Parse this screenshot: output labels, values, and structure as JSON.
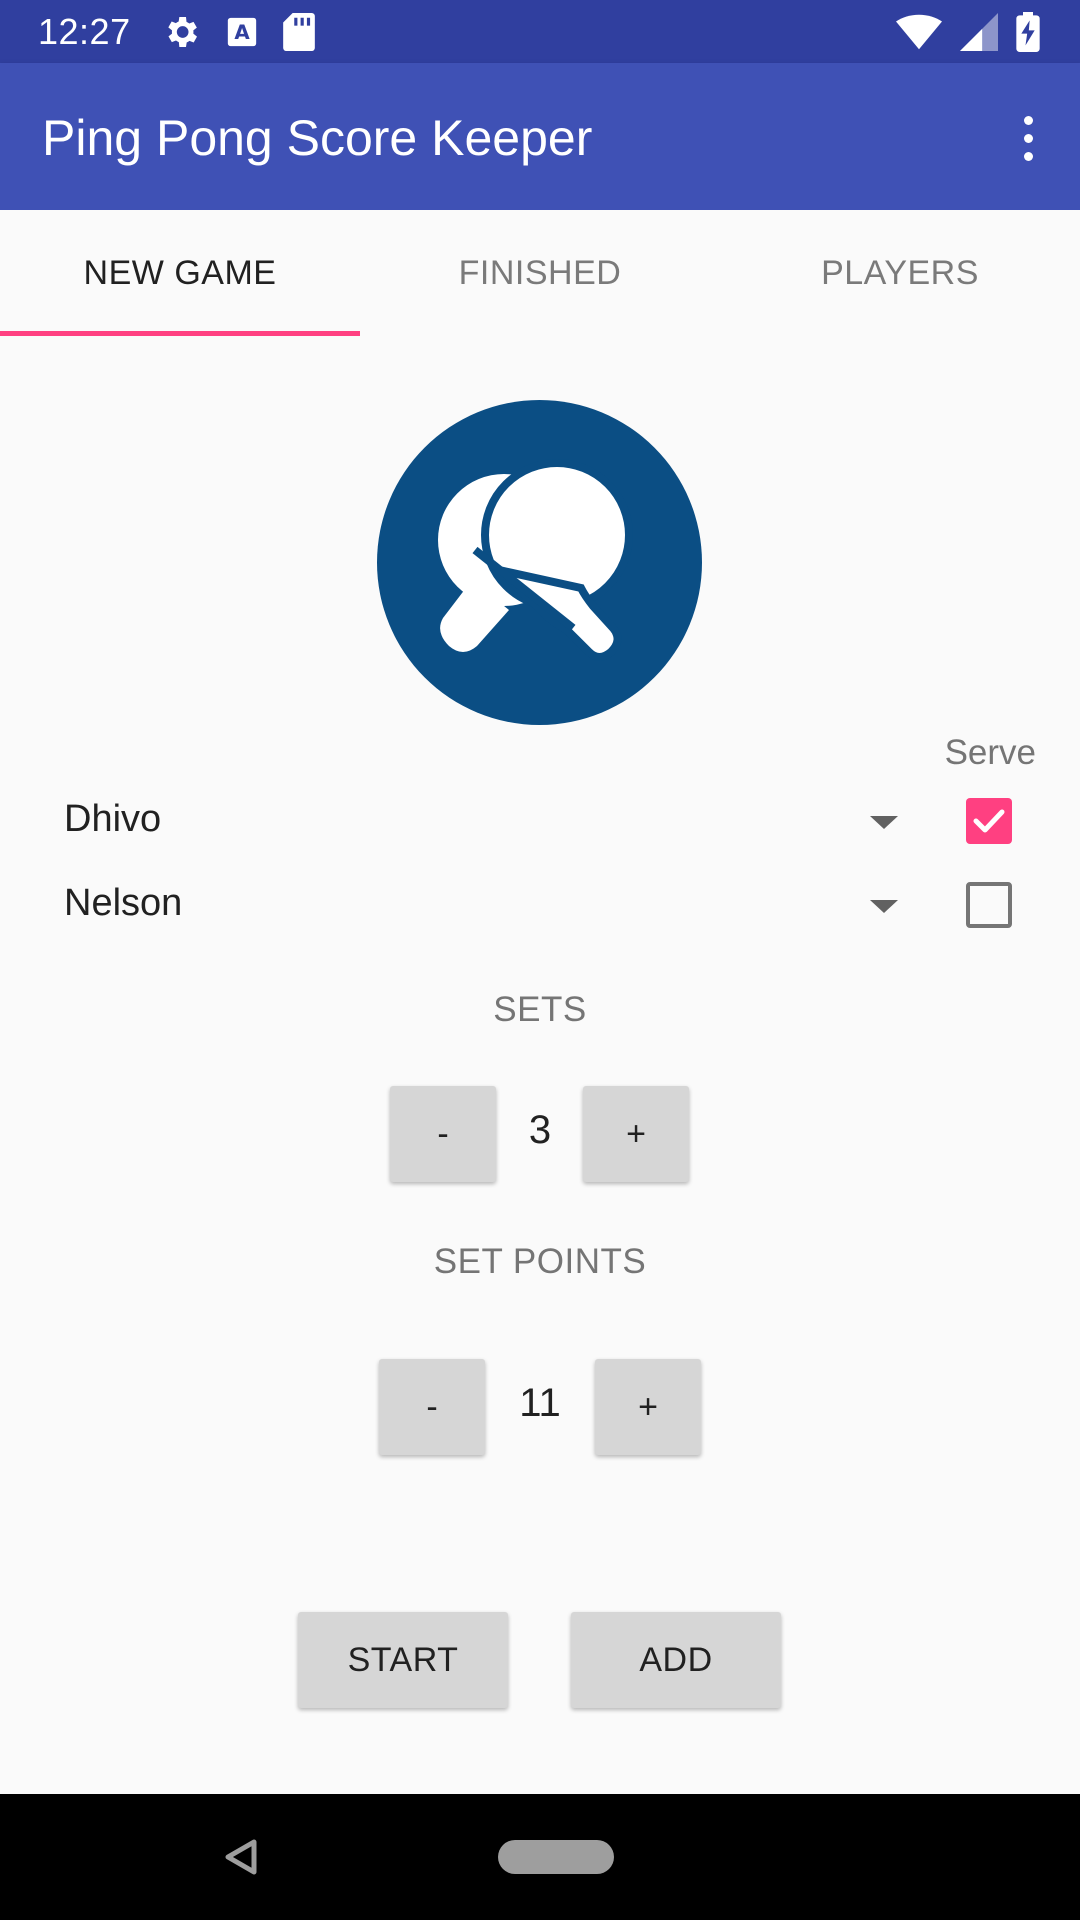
{
  "status_bar": {
    "time": "12:27",
    "left_icons": [
      "gear-icon",
      "a-icon",
      "sd-card-icon"
    ],
    "right_icons": [
      "wifi-icon",
      "signal-icon",
      "battery-charging-icon"
    ]
  },
  "app_bar": {
    "title": "Ping Pong Score Keeper",
    "menu_icon": "more-vert-icon"
  },
  "tabs": [
    {
      "label": "NEW GAME",
      "active": true
    },
    {
      "label": "FINISHED",
      "active": false
    },
    {
      "label": "PLAYERS",
      "active": false
    }
  ],
  "logo": {
    "icon": "ping-pong-paddle-icon",
    "color": "#0b4e84"
  },
  "serve_label": "Serve",
  "players": [
    {
      "name": "Dhivo",
      "serve": true
    },
    {
      "name": "Nelson",
      "serve": false
    }
  ],
  "sets": {
    "label": "SETS",
    "value": "3",
    "minus": "-",
    "plus": "+"
  },
  "set_points": {
    "label": "SET POINTS",
    "value": "11",
    "minus": "-",
    "plus": "+"
  },
  "actions": {
    "start": "START",
    "add": "ADD"
  },
  "colors": {
    "primary": "#3f51b5",
    "primary_dark": "#303f9f",
    "accent": "#ff4081"
  }
}
